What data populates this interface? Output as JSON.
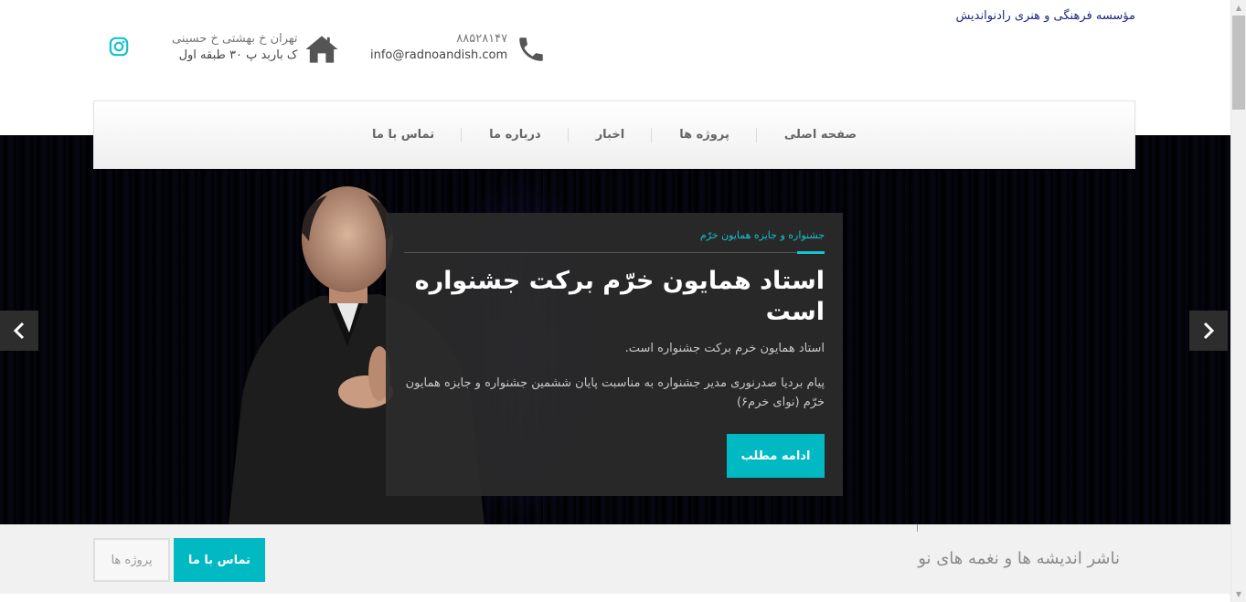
{
  "header": {
    "site_name": "مؤسسه فرهنگی و هنری رادنواندیش",
    "phone": "۸۸۵۲۸۱۴۷",
    "email": "info@radnoandish.com",
    "address_line1": "تهران خ بهشتی خ حسینی",
    "address_line2": "ک باربد پ ۳۰ طبقه اول",
    "icons": {
      "phone": "phone-icon",
      "home": "home-icon",
      "instagram": "instagram-icon"
    }
  },
  "nav": {
    "items": [
      {
        "label": "صفحه اصلی"
      },
      {
        "label": "پروژه ها"
      },
      {
        "label": "اخبار"
      },
      {
        "label": "درباره ما"
      },
      {
        "label": "تماس با ما"
      }
    ]
  },
  "slider": {
    "category": "جشنواره و جایزه همایون خرّم",
    "headline": "استاد همایون خرّم برکت جشنواره است",
    "subtitle": "استاد همایون خرم برکت جشنواره است.",
    "description": "پیام بردیا صدرنوری مدیر جشنواره به مناسبت پایان ششمین جشنواره و جایزه همایون خرّم (نوای خرم۶)",
    "cta_label": "ادامه مطلب",
    "prev_icon": "chevron-left-icon",
    "next_icon": "chevron-right-icon"
  },
  "banner": {
    "tagline": "ناشر اندیشه ها و نغمه های نو",
    "contact_button": "تماس با ما",
    "projects_button": "پروژه ها"
  },
  "colors": {
    "accent": "#00b9c2",
    "site_name": "#1b2a80",
    "card_bg": "#2b2b2b"
  }
}
